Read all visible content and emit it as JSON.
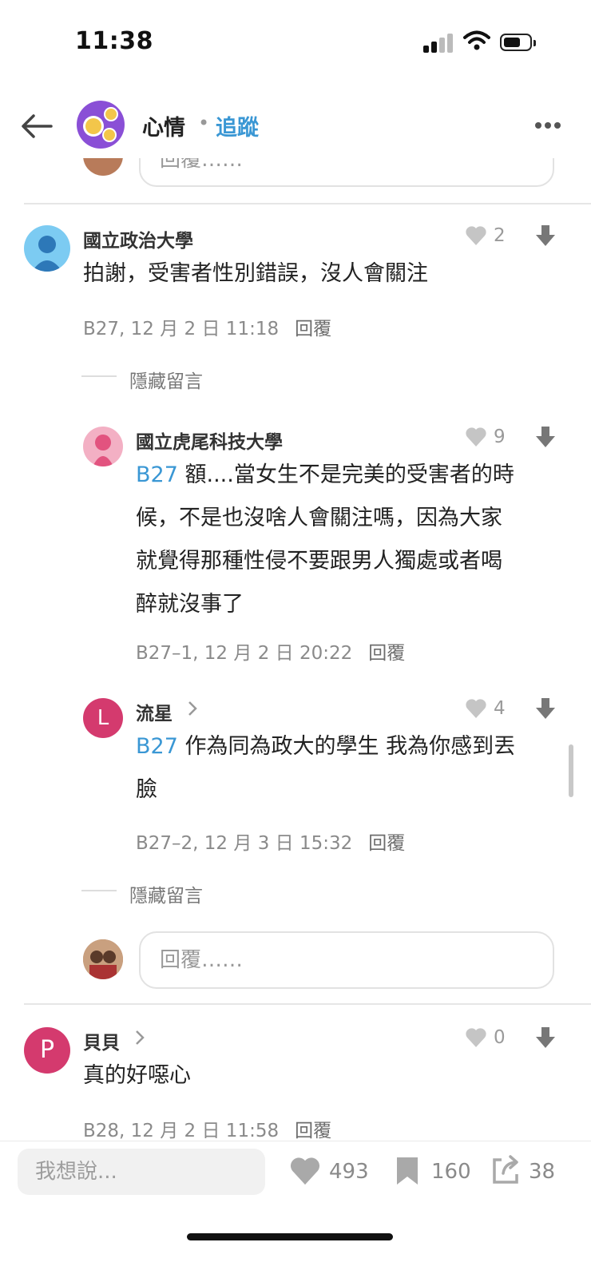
{
  "status_bar": {
    "time": "11:38"
  },
  "header": {
    "board_name": "心情",
    "separator": "•",
    "follow_label": "追蹤"
  },
  "reply_placeholder": "回覆……",
  "comments": [
    {
      "author": "國立政治大學",
      "text": "拍謝，受害者性別錯誤，沒人會關注",
      "likes": "2",
      "meta": "B27, 12 月 2 日 11:18",
      "reply_label": "回覆",
      "hide_label": "隱藏留言",
      "replies": [
        {
          "author": "國立虎尾科技大學",
          "tag": "B27",
          "text_lines": [
            "額....當女生不是完美的受害者的時",
            "候，不是也沒啥人會關注嗎，因為大家",
            "就覺得那種性侵不要跟男人獨處或者喝",
            "醉就沒事了"
          ],
          "likes": "9",
          "meta": "B27–1, 12 月 2 日 20:22",
          "reply_label": "回覆"
        },
        {
          "author": "流星",
          "avatar_letter": "L",
          "tag": "B27",
          "text_lines": [
            "作為同為政大的學生 我為你感到丟",
            "臉"
          ],
          "likes": "4",
          "meta": "B27–2, 12 月 3 日 15:32",
          "reply_label": "回覆"
        }
      ],
      "hide_label_2": "隱藏留言"
    },
    {
      "author": "貝貝",
      "avatar_letter": "P",
      "text": "真的好噁心",
      "likes": "0",
      "meta": "B28, 12 月 2 日 11:58",
      "reply_label": "回覆"
    }
  ],
  "bottom_bar": {
    "input_placeholder": "我想說...",
    "likes": "493",
    "bookmarks": "160",
    "shares": "38"
  },
  "colors": {
    "accent": "#3a97d4",
    "avatar_pink": "#d43a6e",
    "board_purple": "#8a4fd6"
  },
  "icons": [
    "back-arrow-icon",
    "more-icon",
    "heart-icon",
    "downvote-icon",
    "chevron-right-icon",
    "bookmark-icon",
    "share-icon"
  ]
}
